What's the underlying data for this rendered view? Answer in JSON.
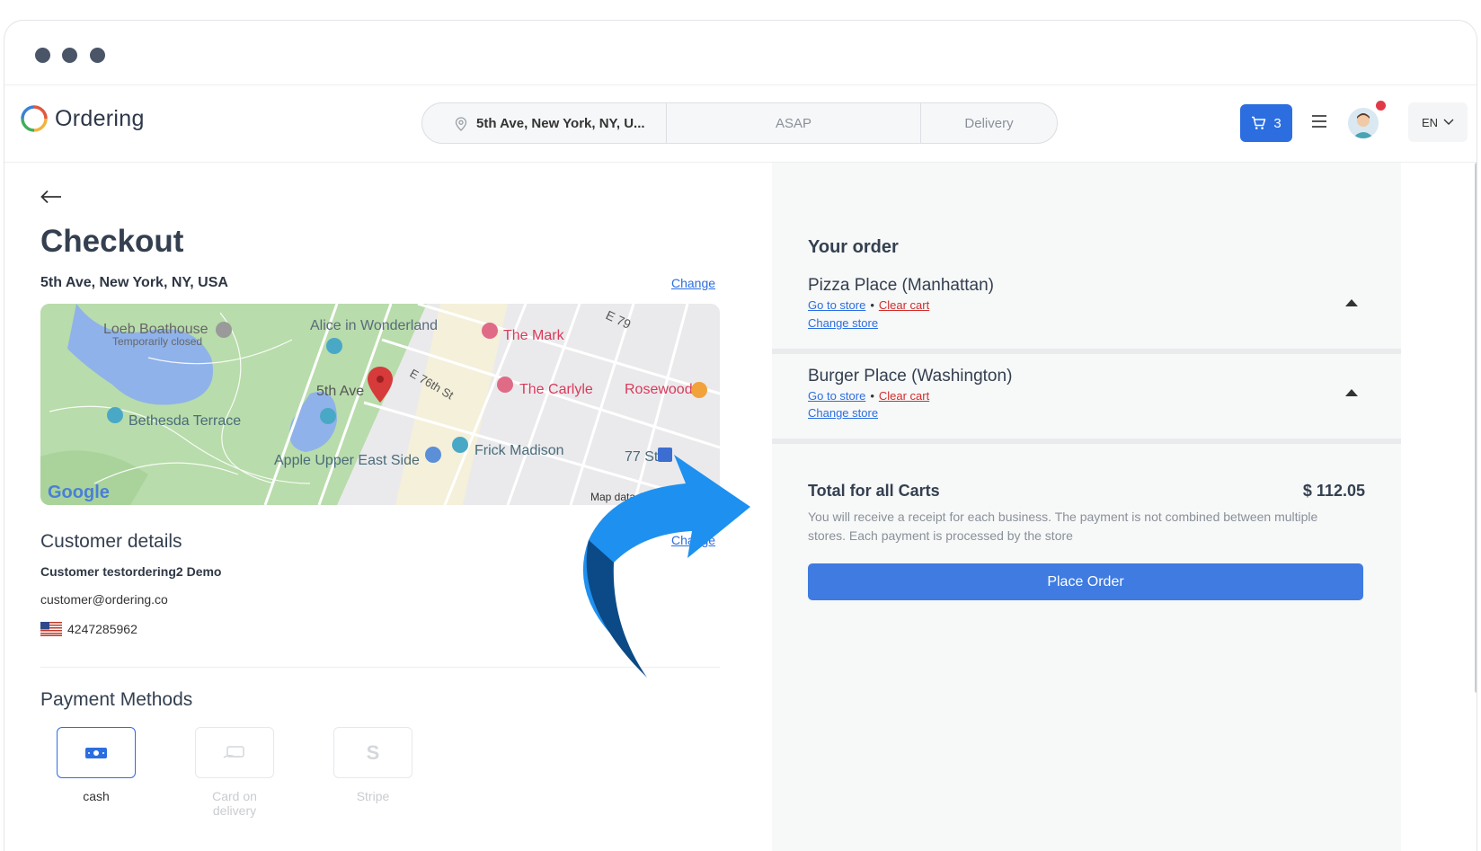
{
  "header": {
    "app_name": "Ordering",
    "search": {
      "address": "5th Ave, New York, NY, U...",
      "time": "ASAP",
      "mode": "Delivery"
    },
    "cart_count": "3",
    "language": "EN"
  },
  "checkout": {
    "title": "Checkout",
    "address": "5th Ave, New York, NY, USA",
    "change_label": "Change",
    "map_labels": [
      "Loeb Boathouse",
      "Temporarily closed",
      "Alice in Wonderland",
      "The Mark",
      "5th Ave",
      "E 76th St",
      "The Carlyle",
      "Rosewood",
      "Bethesda Terrace",
      "Apple Upper East Side",
      "Frick Madison",
      "77 St",
      "E 79",
      "Google",
      "Map data ©2023 Google"
    ],
    "customer": {
      "title": "Customer details",
      "change_label": "Change",
      "name": "Customer testordering2 Demo",
      "email": "customer@ordering.co",
      "phone": "4247285962"
    },
    "payment": {
      "title": "Payment Methods",
      "methods": [
        {
          "label": "cash",
          "icon": "cash-icon",
          "selected": true
        },
        {
          "label": "Card on delivery",
          "icon": "card-hand-icon",
          "selected": false
        },
        {
          "label": "Stripe",
          "icon": "stripe-s-icon",
          "selected": false
        }
      ]
    }
  },
  "order": {
    "title": "Your order",
    "stores": [
      {
        "name": "Pizza Place (Manhattan)",
        "go_to_store": "Go to store",
        "clear_cart": "Clear cart",
        "change_store": "Change store"
      },
      {
        "name": "Burger Place (Washington)",
        "go_to_store": "Go to store",
        "clear_cart": "Clear cart",
        "change_store": "Change store"
      }
    ],
    "total_label": "Total for all Carts",
    "total_value": "$ 112.05",
    "receipt_note": "You will receive a receipt for each business. The payment is not combined between multiple stores. Each payment is processed by the store",
    "place_order": "Place Order"
  },
  "colors": {
    "accent": "#2c6ee0",
    "danger": "#d12d2d",
    "arrow": "#1e90ef"
  }
}
